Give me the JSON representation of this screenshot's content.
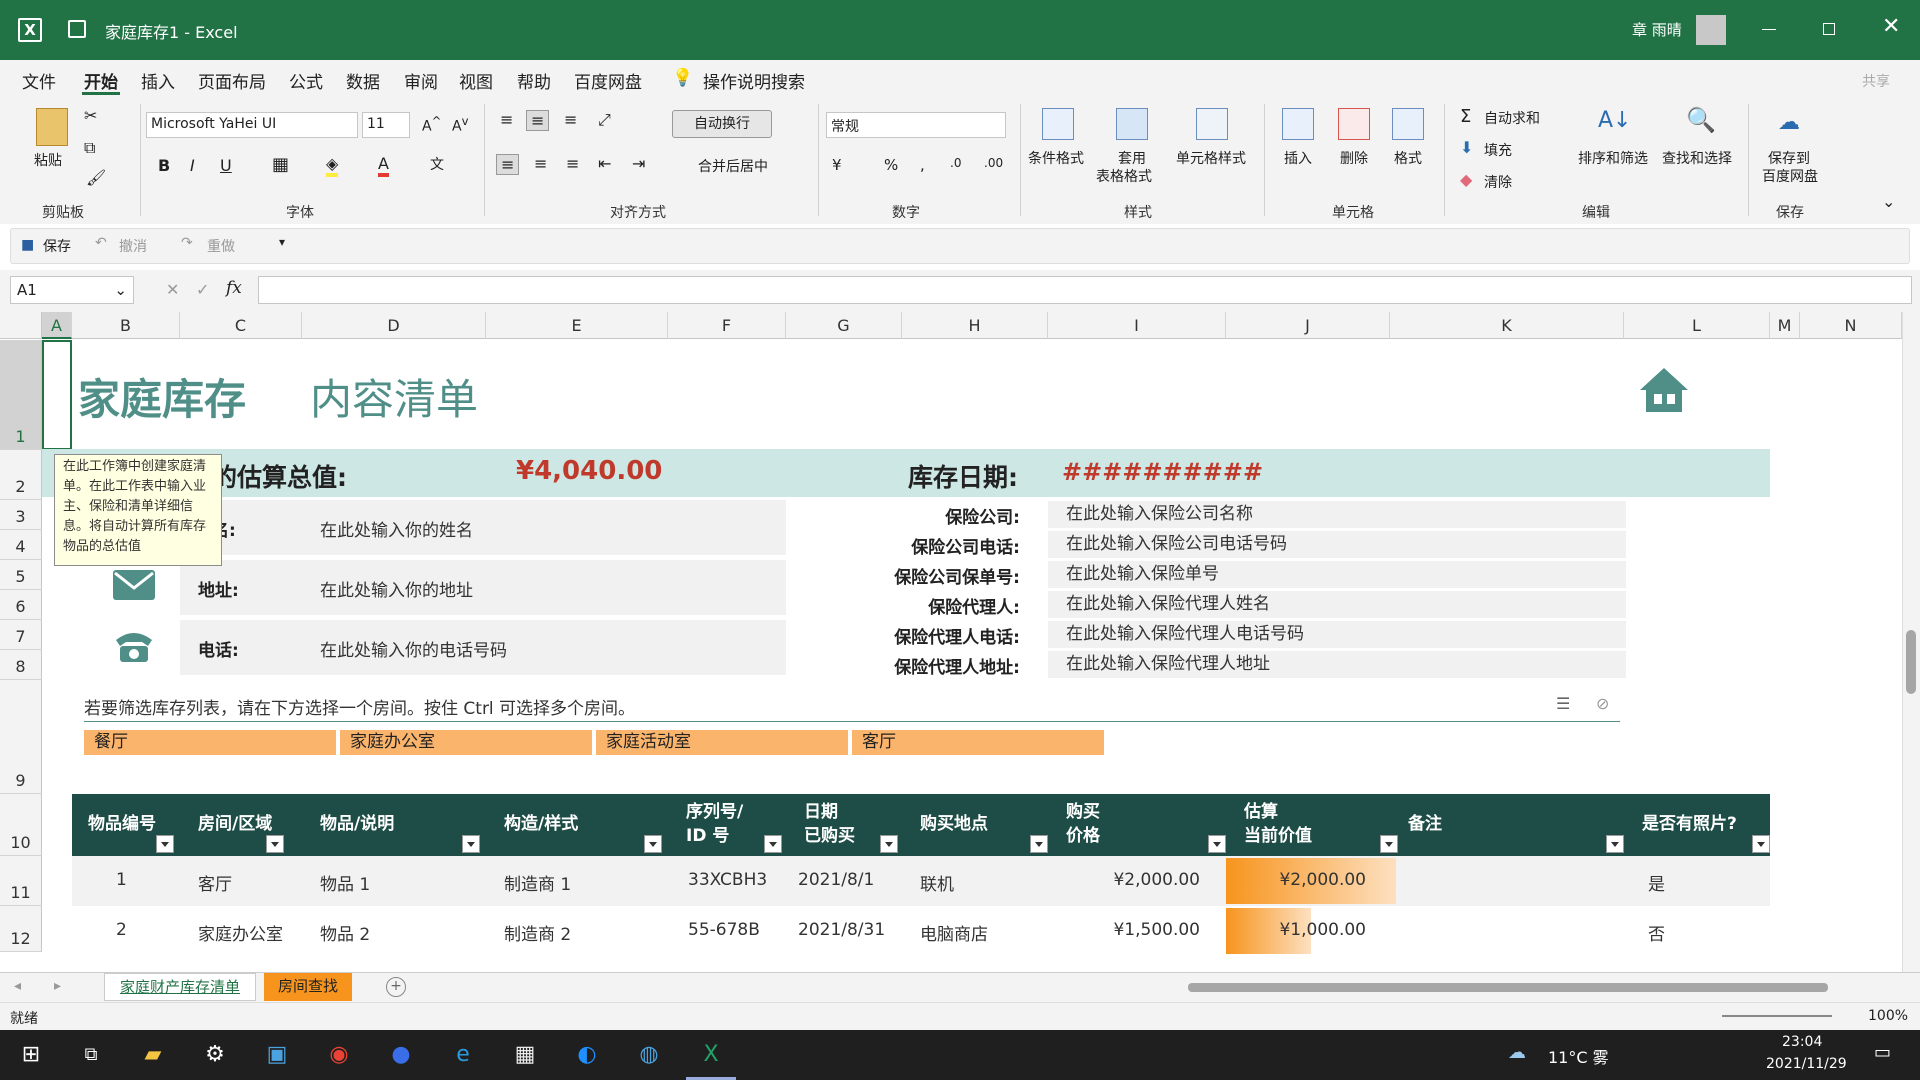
{
  "titlebar": {
    "doc_title": "家庭库存1  -  Excel",
    "user": "章 雨晴"
  },
  "menu": {
    "items": [
      "文件",
      "开始",
      "插入",
      "页面布局",
      "公式",
      "数据",
      "审阅",
      "视图",
      "帮助",
      "百度网盘"
    ],
    "search": "操作说明搜索",
    "share": "共享"
  },
  "ribbon": {
    "clipboard": {
      "paste": "粘贴",
      "group": "剪贴板"
    },
    "font": {
      "name": "Microsoft YaHei UI",
      "size": "11",
      "group": "字体",
      "bold": "B",
      "italic": "I",
      "underline": "U"
    },
    "alignment": {
      "wrap": "自动换行",
      "merge": "合并后居中",
      "group": "对齐方式"
    },
    "number": {
      "format": "常规",
      "group": "数字"
    },
    "styles": {
      "conditional": "条件格式",
      "table_1": "套用",
      "table_2": "表格格式",
      "cell_styles": "单元格样式",
      "group": "样式"
    },
    "cells": {
      "insert": "插入",
      "delete": "删除",
      "format": "格式",
      "group": "单元格"
    },
    "editing": {
      "autosum": "自动求和",
      "fill": "填充",
      "clear": "清除",
      "sort": "排序和筛选",
      "find": "查找和选择",
      "group": "编辑"
    },
    "save": {
      "save_1": "保存到",
      "save_2": "百度网盘",
      "group": "保存"
    }
  },
  "qat": {
    "save": "保存",
    "undo": "撤消",
    "redo": "重做"
  },
  "formula_bar": {
    "name_box": "A1",
    "fx": "fx",
    "value": ""
  },
  "columns": [
    "A",
    "B",
    "C",
    "D",
    "E",
    "F",
    "G",
    "H",
    "I",
    "J",
    "K",
    "L",
    "M",
    "N"
  ],
  "rows": [
    "1",
    "2",
    "3",
    "4",
    "5",
    "6",
    "7",
    "8",
    "9",
    "10",
    "11",
    "12"
  ],
  "sheet": {
    "title": "家庭库存",
    "subtitle": "内容清单",
    "total_label": "的估算总值:",
    "total_value": "¥4,040.00",
    "date_label": "库存日期:",
    "date_value": "##########",
    "tooltip": "在此工作簿中创建家庭清单。在此工作表中输入业主、保险和清单详细信息。将自动计算所有库存物品的总估值",
    "owner": [
      {
        "label": "名:",
        "value": "在此处输入你的姓名"
      },
      {
        "label": "地址:",
        "value": "在此处输入你的地址"
      },
      {
        "label": "电话:",
        "value": "在此处输入你的电话号码"
      }
    ],
    "insurance": [
      {
        "label": "保险公司:",
        "value": "在此处输入保险公司名称"
      },
      {
        "label": "保险公司电话:",
        "value": "在此处输入保险公司电话号码"
      },
      {
        "label": "保险公司保单号:",
        "value": "在此处输入保险单号"
      },
      {
        "label": "保险代理人:",
        "value": "在此处输入保险代理人姓名"
      },
      {
        "label": "保险代理人电话:",
        "value": "在此处输入保险代理人电话号码"
      },
      {
        "label": "保险代理人地址:",
        "value": "在此处输入保险代理人地址"
      }
    ],
    "filter_hint": "若要筛选库存列表，请在下方选择一个房间。按住 Ctrl 可选择多个房间。",
    "slicers": [
      "餐厅",
      "家庭办公室",
      "家庭活动室",
      "客厅"
    ],
    "table_headers": [
      "物品编号",
      "房间/区域",
      "物品/说明",
      "构造/样式",
      "序列号/\nID 号",
      "日期\n已购买",
      "购买地点",
      "购买\n价格",
      "估算\n当前价值",
      "备注",
      "是否有照片?"
    ],
    "table_rows": [
      {
        "no": "1",
        "room": "客厅",
        "item": "物品 1",
        "make": "制造商 1",
        "serial": "33XCBH3",
        "date": "2021/8/1",
        "where": "联机",
        "price": "¥2,000.00",
        "value": "¥2,000.00",
        "value_fill": 1.0,
        "note": "",
        "photo": "是"
      },
      {
        "no": "2",
        "room": "家庭办公室",
        "item": "物品 2",
        "make": "制造商 2",
        "serial": "55-678B",
        "date": "2021/8/31",
        "where": "电脑商店",
        "price": "¥1,500.00",
        "value": "¥1,000.00",
        "value_fill": 0.5,
        "note": "",
        "photo": "否"
      }
    ],
    "value_fill_color": "#f7941d",
    "theme_color": "#1e4d47",
    "title_color": "#4f8f88"
  },
  "sheet_tabs": [
    "家庭财产库存清单",
    "房间查找"
  ],
  "status": {
    "ready": "就绪",
    "zoom": "100%"
  },
  "taskbar": {
    "weather": "11°C 雾",
    "time": "23:04",
    "date": "2021/11/29"
  }
}
